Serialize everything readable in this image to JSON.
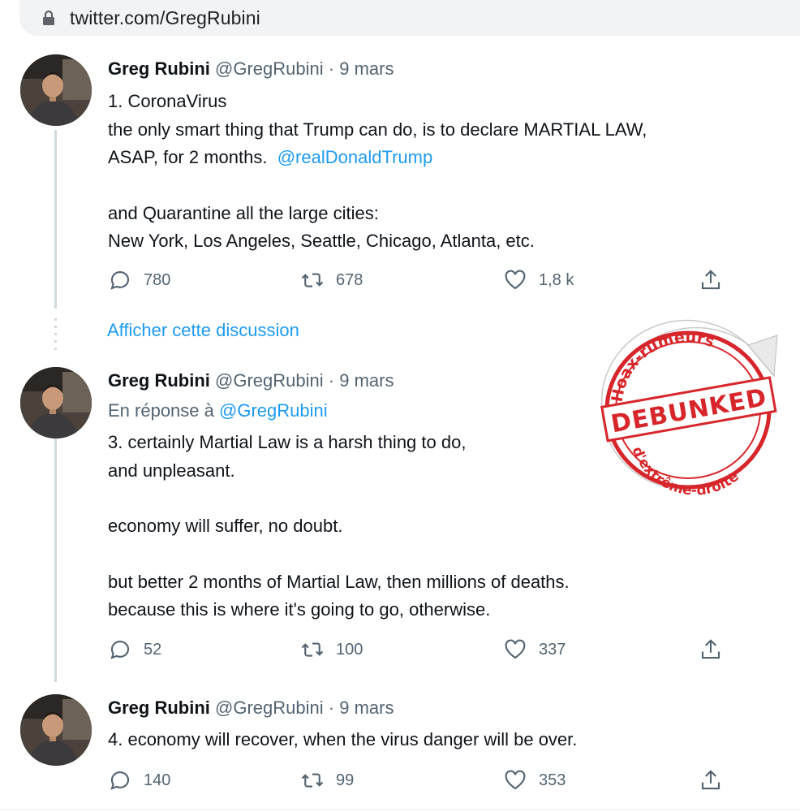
{
  "browser": {
    "url": "twitter.com/GregRubini"
  },
  "tweets": [
    {
      "name": "Greg Rubini",
      "handle": "@GregRubini",
      "separator": "·",
      "date": "9 mars",
      "lines": [
        "1. CoronaVirus",
        "the only smart thing that Trump can do, is to declare MARTIAL LAW,",
        "ASAP, for 2 months."
      ],
      "mention": "@realDonaldTrump",
      "lines2": [
        "and Quarantine all the large cities:",
        "New York, Los Angeles, Seattle, Chicago, Atlanta, etc."
      ],
      "replies": "780",
      "retweets": "678",
      "likes": "1,8 k"
    },
    {
      "name": "Greg Rubini",
      "handle": "@GregRubini",
      "separator": "·",
      "date": "9 mars",
      "reply_prefix": "En réponse à",
      "reply_to": "@GregRubini",
      "lines": [
        "3. certainly Martial Law is a harsh thing to do,",
        "and unpleasant."
      ],
      "lines2": [
        "economy will suffer, no doubt."
      ],
      "lines3": [
        "but better 2 months of Martial Law, then millions of deaths.",
        "because this is where it's going to go, otherwise."
      ],
      "replies": "52",
      "retweets": "100",
      "likes": "337"
    },
    {
      "name": "Greg Rubini",
      "handle": "@GregRubini",
      "separator": "·",
      "date": "9 mars",
      "lines": [
        "4. economy will recover, when the virus danger will be over."
      ],
      "replies": "140",
      "retweets": "99",
      "likes": "353"
    }
  ],
  "show_thread": "Afficher cette discussion",
  "stamp": {
    "top_text": "Hoax-rumeurs",
    "center_text": "DEBUNKED",
    "bottom_text": "d'extrême-droite",
    "color": "#d7262b"
  },
  "colors": {
    "link": "#1d9bf0",
    "muted": "#536471",
    "text": "#0f1419"
  }
}
